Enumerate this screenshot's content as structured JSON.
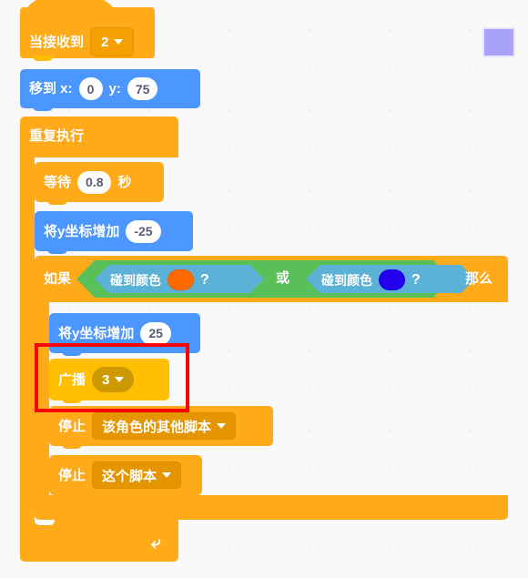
{
  "workspace": {
    "background_color": "#f9f9f9",
    "grid_dot_color": "#e9e9ef"
  },
  "script": {
    "hat": {
      "label": "当接收到",
      "dropdown_value": "2",
      "category": "events",
      "color": "#ffab19"
    },
    "goto_xy": {
      "label": "移到 x:",
      "x_value": "0",
      "y_label": "y:",
      "y_value": "75",
      "category": "motion",
      "color": "#4c97ff"
    },
    "forever": {
      "label": "重复执行",
      "category": "control",
      "color": "#ffab19",
      "loop_arrow": "↻"
    },
    "wait": {
      "label": "等待",
      "value": "0.8",
      "unit": "秒",
      "category": "control",
      "color": "#ffab19"
    },
    "change_y_down": {
      "label": "将y坐标增加",
      "value": "-25",
      "category": "motion",
      "color": "#4c97ff"
    },
    "if_then": {
      "label_if": "如果",
      "label_then": "那么",
      "category": "control",
      "color": "#ffab19",
      "operator": {
        "label": "或",
        "category": "operators",
        "color": "#59c059"
      },
      "condition_a": {
        "label": "碰到颜色",
        "question": "?",
        "swatch_color": "#ff6a00",
        "category": "sensing",
        "color": "#5cb1d6"
      },
      "condition_b": {
        "label": "碰到颜色",
        "question": "?",
        "swatch_color": "#2200ee",
        "category": "sensing",
        "color": "#5cb1d6"
      }
    },
    "change_y_up": {
      "label": "将y坐标增加",
      "value": "25",
      "category": "motion",
      "color": "#4c97ff"
    },
    "broadcast": {
      "label": "广播",
      "dropdown_value": "3",
      "category": "events",
      "color": "#ffbf00"
    },
    "stop_other": {
      "label": "停止",
      "dropdown_value": "该角色的其他脚本",
      "category": "control",
      "color": "#ffab19"
    },
    "stop_this": {
      "label": "停止",
      "dropdown_value": "这个脚本",
      "category": "control",
      "color": "#ffab19"
    }
  },
  "annotations": {
    "highlight": {
      "color": "#ff0000",
      "target": "broadcast"
    },
    "purple_square": {
      "fill_color": "#a9a2fa",
      "border_color": "#e8e6fe"
    }
  }
}
